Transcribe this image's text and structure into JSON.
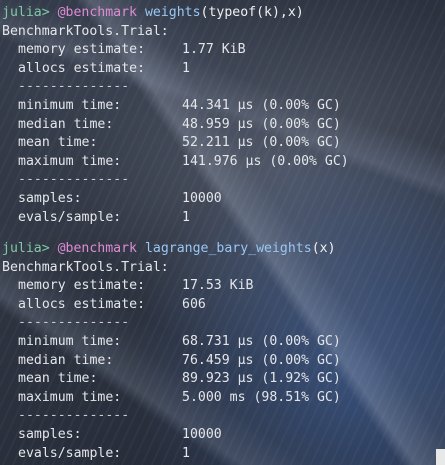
{
  "runs": [
    {
      "prompt": "julia>",
      "macro": "@benchmark",
      "call_name": "weights",
      "call_args": "(typeof(k),x)",
      "header": "BenchmarkTools.Trial:",
      "memory_label": "memory estimate:",
      "memory_value": "1.77 KiB",
      "allocs_label": "allocs estimate:",
      "allocs_value": "1",
      "separator": "--------------",
      "min_label": "minimum time:",
      "min_value": "44.341 μs (0.00% GC)",
      "median_label": "median time:",
      "median_value": "48.959 μs (0.00% GC)",
      "mean_label": "mean time:",
      "mean_value": "52.211 μs (0.00% GC)",
      "max_label": "maximum time:",
      "max_value": "141.976 μs (0.00% GC)",
      "samples_label": "samples:",
      "samples_value": "10000",
      "evals_label": "evals/sample:",
      "evals_value": "1"
    },
    {
      "prompt": "julia>",
      "macro": "@benchmark",
      "call_name": "lagrange_bary_weights",
      "call_args": "(x)",
      "header": "BenchmarkTools.Trial:",
      "memory_label": "memory estimate:",
      "memory_value": "17.53 KiB",
      "allocs_label": "allocs estimate:",
      "allocs_value": "606",
      "separator": "--------------",
      "min_label": "minimum time:",
      "min_value": "68.731 μs (0.00% GC)",
      "median_label": "median time:",
      "median_value": "76.459 μs (0.00% GC)",
      "mean_label": "mean time:",
      "mean_value": "89.923 μs (1.92% GC)",
      "max_label": "maximum time:",
      "max_value": "5.000 ms (98.51% GC)",
      "samples_label": "samples:",
      "samples_value": "10000",
      "evals_label": "evals/sample:",
      "evals_value": "1"
    }
  ],
  "colors": {
    "prompt": "#7fc9a5",
    "macro": "#dd8cd4",
    "call": "#9ac7f2",
    "text": "#e4e6ea"
  }
}
